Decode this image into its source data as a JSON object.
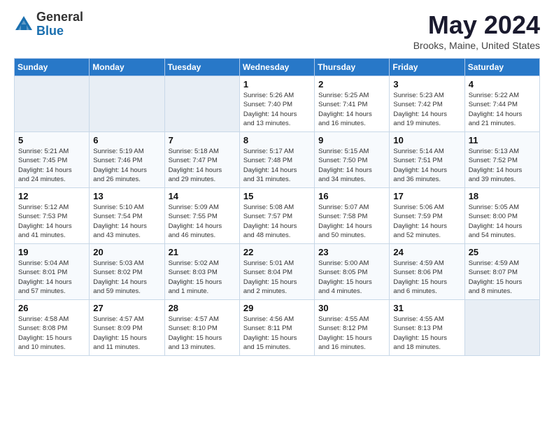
{
  "logo": {
    "general": "General",
    "blue": "Blue"
  },
  "title": "May 2024",
  "location": "Brooks, Maine, United States",
  "weekdays": [
    "Sunday",
    "Monday",
    "Tuesday",
    "Wednesday",
    "Thursday",
    "Friday",
    "Saturday"
  ],
  "weeks": [
    [
      {
        "day": "",
        "info": ""
      },
      {
        "day": "",
        "info": ""
      },
      {
        "day": "",
        "info": ""
      },
      {
        "day": "1",
        "info": "Sunrise: 5:26 AM\nSunset: 7:40 PM\nDaylight: 14 hours\nand 13 minutes."
      },
      {
        "day": "2",
        "info": "Sunrise: 5:25 AM\nSunset: 7:41 PM\nDaylight: 14 hours\nand 16 minutes."
      },
      {
        "day": "3",
        "info": "Sunrise: 5:23 AM\nSunset: 7:42 PM\nDaylight: 14 hours\nand 19 minutes."
      },
      {
        "day": "4",
        "info": "Sunrise: 5:22 AM\nSunset: 7:44 PM\nDaylight: 14 hours\nand 21 minutes."
      }
    ],
    [
      {
        "day": "5",
        "info": "Sunrise: 5:21 AM\nSunset: 7:45 PM\nDaylight: 14 hours\nand 24 minutes."
      },
      {
        "day": "6",
        "info": "Sunrise: 5:19 AM\nSunset: 7:46 PM\nDaylight: 14 hours\nand 26 minutes."
      },
      {
        "day": "7",
        "info": "Sunrise: 5:18 AM\nSunset: 7:47 PM\nDaylight: 14 hours\nand 29 minutes."
      },
      {
        "day": "8",
        "info": "Sunrise: 5:17 AM\nSunset: 7:48 PM\nDaylight: 14 hours\nand 31 minutes."
      },
      {
        "day": "9",
        "info": "Sunrise: 5:15 AM\nSunset: 7:50 PM\nDaylight: 14 hours\nand 34 minutes."
      },
      {
        "day": "10",
        "info": "Sunrise: 5:14 AM\nSunset: 7:51 PM\nDaylight: 14 hours\nand 36 minutes."
      },
      {
        "day": "11",
        "info": "Sunrise: 5:13 AM\nSunset: 7:52 PM\nDaylight: 14 hours\nand 39 minutes."
      }
    ],
    [
      {
        "day": "12",
        "info": "Sunrise: 5:12 AM\nSunset: 7:53 PM\nDaylight: 14 hours\nand 41 minutes."
      },
      {
        "day": "13",
        "info": "Sunrise: 5:10 AM\nSunset: 7:54 PM\nDaylight: 14 hours\nand 43 minutes."
      },
      {
        "day": "14",
        "info": "Sunrise: 5:09 AM\nSunset: 7:55 PM\nDaylight: 14 hours\nand 46 minutes."
      },
      {
        "day": "15",
        "info": "Sunrise: 5:08 AM\nSunset: 7:57 PM\nDaylight: 14 hours\nand 48 minutes."
      },
      {
        "day": "16",
        "info": "Sunrise: 5:07 AM\nSunset: 7:58 PM\nDaylight: 14 hours\nand 50 minutes."
      },
      {
        "day": "17",
        "info": "Sunrise: 5:06 AM\nSunset: 7:59 PM\nDaylight: 14 hours\nand 52 minutes."
      },
      {
        "day": "18",
        "info": "Sunrise: 5:05 AM\nSunset: 8:00 PM\nDaylight: 14 hours\nand 54 minutes."
      }
    ],
    [
      {
        "day": "19",
        "info": "Sunrise: 5:04 AM\nSunset: 8:01 PM\nDaylight: 14 hours\nand 57 minutes."
      },
      {
        "day": "20",
        "info": "Sunrise: 5:03 AM\nSunset: 8:02 PM\nDaylight: 14 hours\nand 59 minutes."
      },
      {
        "day": "21",
        "info": "Sunrise: 5:02 AM\nSunset: 8:03 PM\nDaylight: 15 hours\nand 1 minute."
      },
      {
        "day": "22",
        "info": "Sunrise: 5:01 AM\nSunset: 8:04 PM\nDaylight: 15 hours\nand 2 minutes."
      },
      {
        "day": "23",
        "info": "Sunrise: 5:00 AM\nSunset: 8:05 PM\nDaylight: 15 hours\nand 4 minutes."
      },
      {
        "day": "24",
        "info": "Sunrise: 4:59 AM\nSunset: 8:06 PM\nDaylight: 15 hours\nand 6 minutes."
      },
      {
        "day": "25",
        "info": "Sunrise: 4:59 AM\nSunset: 8:07 PM\nDaylight: 15 hours\nand 8 minutes."
      }
    ],
    [
      {
        "day": "26",
        "info": "Sunrise: 4:58 AM\nSunset: 8:08 PM\nDaylight: 15 hours\nand 10 minutes."
      },
      {
        "day": "27",
        "info": "Sunrise: 4:57 AM\nSunset: 8:09 PM\nDaylight: 15 hours\nand 11 minutes."
      },
      {
        "day": "28",
        "info": "Sunrise: 4:57 AM\nSunset: 8:10 PM\nDaylight: 15 hours\nand 13 minutes."
      },
      {
        "day": "29",
        "info": "Sunrise: 4:56 AM\nSunset: 8:11 PM\nDaylight: 15 hours\nand 15 minutes."
      },
      {
        "day": "30",
        "info": "Sunrise: 4:55 AM\nSunset: 8:12 PM\nDaylight: 15 hours\nand 16 minutes."
      },
      {
        "day": "31",
        "info": "Sunrise: 4:55 AM\nSunset: 8:13 PM\nDaylight: 15 hours\nand 18 minutes."
      },
      {
        "day": "",
        "info": ""
      }
    ]
  ]
}
